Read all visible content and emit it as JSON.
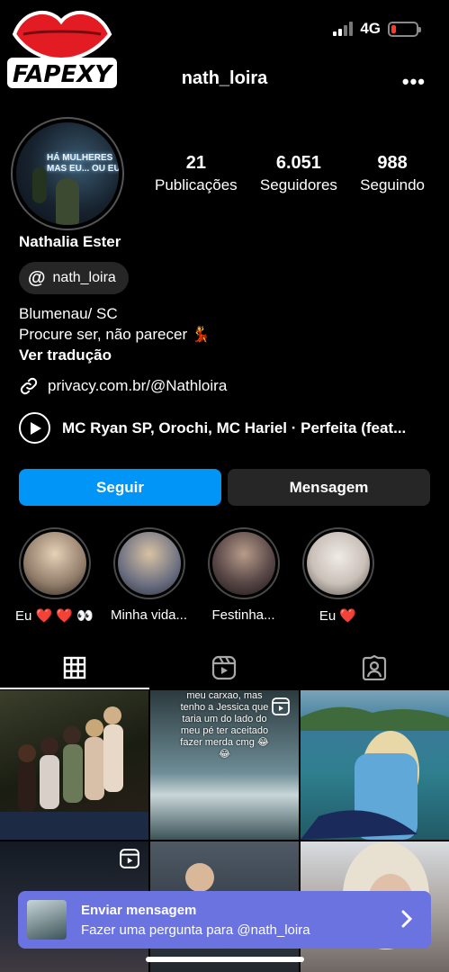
{
  "status": {
    "network": "4G"
  },
  "logo": {
    "text": "FAPEXY"
  },
  "header": {
    "username": "nath_loira",
    "more_label": "•••"
  },
  "avatar": {
    "neon_text": "HÁ MULHERES\nMAS EU... OU EU"
  },
  "stats": [
    {
      "value": "21",
      "label": "Publicações"
    },
    {
      "value": "6.051",
      "label": "Seguidores"
    },
    {
      "value": "988",
      "label": "Seguindo"
    }
  ],
  "profile": {
    "full_name": "Nathalia Ester",
    "threads_handle": "nath_loira",
    "bio_line1": "Blumenau/ SC",
    "bio_line2": "Procure ser, não parecer 💃",
    "translate": "Ver tradução",
    "link": "privacy.com.br/@Nathloira",
    "music": "MC Ryan SP, Orochi, MC Hariel · Perfeita (feat..."
  },
  "buttons": {
    "follow": "Seguir",
    "message": "Mensagem"
  },
  "highlights": [
    {
      "label": "Eu ❤️ ❤️ 👀",
      "color": "#c9b9a6"
    },
    {
      "label": "Minha vida...",
      "color": "#a39a8c"
    },
    {
      "label": "Festinha...",
      "color": "#5a4848"
    },
    {
      "label": "Eu ❤️",
      "color": "#d8d2cc"
    }
  ],
  "grid": {
    "caption_2": "meu carxao, mas tenho a Jessica que taria um do lado do meu pé ter aceitado fazer merda cmg 😂😂"
  },
  "banner": {
    "title": "Enviar mensagem",
    "subtitle": "Fazer uma pergunta para @nath_loira"
  }
}
